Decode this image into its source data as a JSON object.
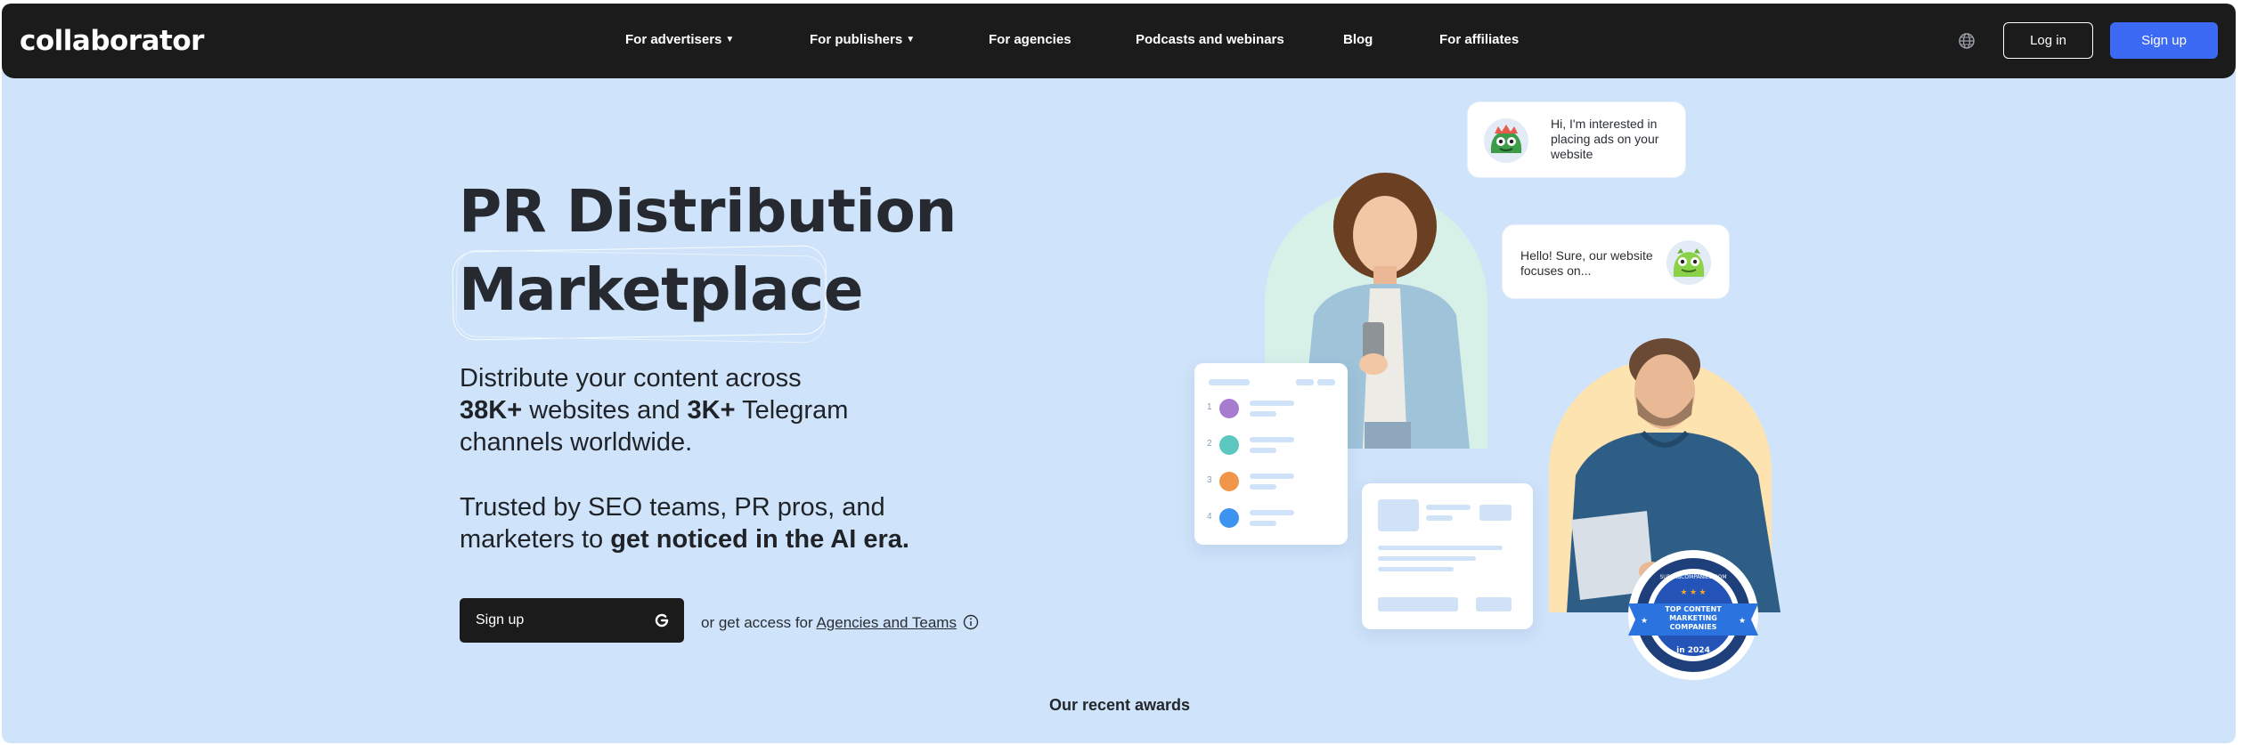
{
  "brand": {
    "logo_text": "collaborator"
  },
  "nav": {
    "items": [
      {
        "label": "For advertisers",
        "has_dropdown": true
      },
      {
        "label": "For publishers",
        "has_dropdown": true
      },
      {
        "label": "For agencies",
        "has_dropdown": false
      },
      {
        "label": "Podcasts and webinars",
        "has_dropdown": false
      },
      {
        "label": "Blog",
        "has_dropdown": false
      },
      {
        "label": "For affiliates",
        "has_dropdown": false
      }
    ],
    "language_icon": "globe-icon",
    "login_label": "Log in",
    "signup_label": "Sign up"
  },
  "hero": {
    "title_line1": "PR Distribution",
    "title_line2": "Marketplace",
    "desc_part1": "Distribute your content across",
    "desc_num1": "38K+",
    "desc_part2": " websites and ",
    "desc_num2": "3K+",
    "desc_part3": " Telegram",
    "desc_part4": "channels worldwide.",
    "trust_part1": "Trusted by SEO teams, PR pros, and",
    "trust_part2": "marketers to ",
    "trust_bold": "get noticed in the AI era.",
    "signup_button": "Sign up",
    "access_prefix": "or get access for ",
    "access_link": "Agencies and Teams"
  },
  "illustration": {
    "bubble_top": "Hi, I'm interested in placing ads on your website",
    "bubble_bottom": "Hello! Sure, our website focuses on...",
    "list_numbers": [
      "1",
      "2",
      "3",
      "4"
    ],
    "list_dot_colors": [
      "#a77bd0",
      "#5cc6c1",
      "#f0964a",
      "#3d93f0"
    ],
    "badge": {
      "ring_text": "SUPERBCOMPANIES.COM",
      "label_line1": "TOP CONTENT",
      "label_line2": "MARKETING",
      "label_line3": "COMPANIES",
      "year": "in 2024"
    }
  },
  "awards": {
    "title": "Our recent awards"
  },
  "colors": {
    "background": "#cfe3fa",
    "navbar": "#1b1b1b",
    "accent_blue": "#3d6af5",
    "text_dark": "#262a30"
  }
}
